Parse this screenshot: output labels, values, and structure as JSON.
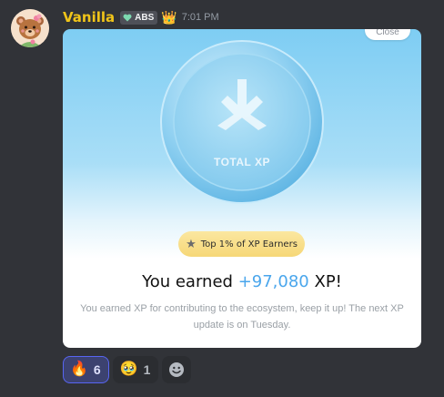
{
  "message": {
    "author": "Vanilla",
    "author_color": "#f0c419",
    "avatar_icon": "bear-avatar",
    "tag_icon": "heart-icon",
    "tag": "ABS",
    "crown_icon": "crown-icon",
    "crown_glyph": "👑",
    "timestamp": "7:01 PM"
  },
  "card": {
    "close_label": "Close",
    "coin_label": "TOTAL XP",
    "badge_label": "Top 1% of XP Earners",
    "earned_prefix": "You earned ",
    "earned_amount": "+97,080",
    "earned_suffix": " XP!",
    "description": "You earned XP for contributing to the ecosystem, keep it up! The next XP update is on Tuesday.",
    "accent_color": "#4aa6ec",
    "badge_color": "#f6d777"
  },
  "reactions": [
    {
      "emoji": "🔥",
      "icon": "fire-icon",
      "count": "6",
      "active": true
    },
    {
      "emoji": "🥹",
      "icon": "teary-face-icon",
      "count": "1",
      "active": false
    }
  ],
  "add_reaction_icon": "smiley-icon"
}
